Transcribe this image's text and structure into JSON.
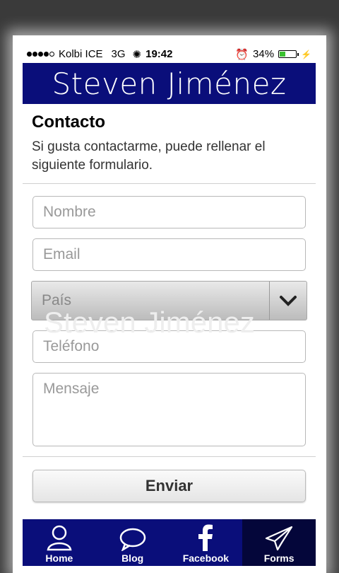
{
  "status": {
    "carrier": "Kolbi ICE",
    "network": "3G",
    "time": "19:42",
    "battery": "34%",
    "battery_level": 0.34
  },
  "header": {
    "title": "Steven Jiménez"
  },
  "intro": {
    "title": "Contacto",
    "text": "Si gusta contactarme, puede rellenar el siguiente formulario."
  },
  "form": {
    "name_placeholder": "Nombre",
    "email_placeholder": "Email",
    "country_placeholder": "País",
    "phone_placeholder": "Teléfono",
    "message_placeholder": "Mensaje",
    "watermark": "Steven Jiménez",
    "send_label": "Enviar"
  },
  "tabs": [
    {
      "label": "Home",
      "icon": "person-icon"
    },
    {
      "label": "Blog",
      "icon": "speech-bubble-icon"
    },
    {
      "label": "Facebook",
      "icon": "facebook-icon"
    },
    {
      "label": "Forms",
      "icon": "paper-plane-icon"
    }
  ],
  "colors": {
    "brand": "#0a0e7a",
    "active_tab": "#04063a",
    "battery": "#3ac130"
  }
}
